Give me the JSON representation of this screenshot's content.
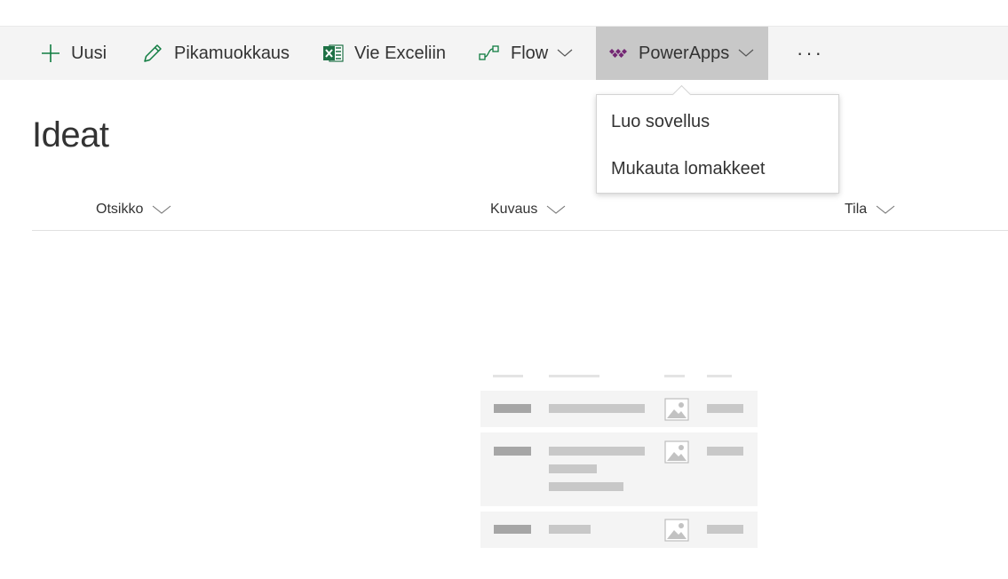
{
  "toolbar": {
    "new_label": "Uusi",
    "quick_edit_label": "Pikamuokkaus",
    "export_excel_label": "Vie Exceliin",
    "flow_label": "Flow",
    "powerapps_label": "PowerApps",
    "more_label": "···"
  },
  "page": {
    "title": "Ideat"
  },
  "list": {
    "columns": [
      {
        "label": "Otsikko"
      },
      {
        "label": "Kuvaus"
      },
      {
        "label": "Tila"
      }
    ]
  },
  "powerapps_menu": {
    "items": [
      "Luo sovellus",
      "Mukauta lomakkeet"
    ]
  },
  "colors": {
    "command_bar_bg": "#f4f4f4",
    "selected_command_bg": "#c8c8c8",
    "accent_green": "#107c41",
    "powerapps_purple": "#742774",
    "icon_green": "#1e7145"
  }
}
